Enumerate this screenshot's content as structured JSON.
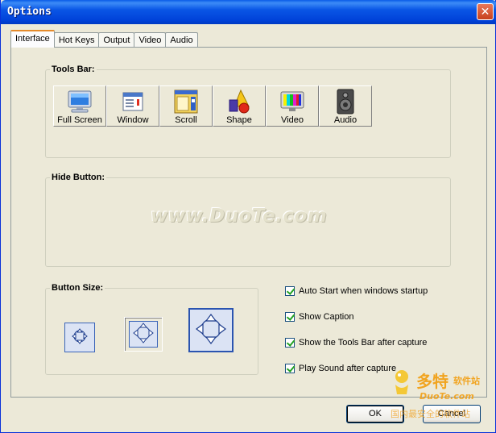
{
  "window": {
    "title": "Options",
    "close_glyph": "✕"
  },
  "tabs": [
    {
      "label": "Interface",
      "active": true
    },
    {
      "label": "Hot Keys",
      "active": false
    },
    {
      "label": "Output",
      "active": false
    },
    {
      "label": "Video",
      "active": false
    },
    {
      "label": "Audio",
      "active": false
    }
  ],
  "tools_bar": {
    "legend": "Tools Bar:",
    "items": [
      {
        "label": "Full Screen",
        "icon": "monitor-icon"
      },
      {
        "label": "Window",
        "icon": "window-icon"
      },
      {
        "label": "Scroll",
        "icon": "scroll-icon"
      },
      {
        "label": "Shape",
        "icon": "shapes-icon"
      },
      {
        "label": "Video",
        "icon": "tv-icon"
      },
      {
        "label": "Audio",
        "icon": "speaker-icon"
      }
    ]
  },
  "hide_button": {
    "legend": "Hide Button:"
  },
  "watermark": "www.DuoTe.com",
  "button_size": {
    "legend": "Button Size:",
    "options": [
      "small",
      "medium",
      "large"
    ],
    "selected": "medium"
  },
  "options": [
    {
      "label": "Auto Start when windows startup",
      "checked": true
    },
    {
      "label": "Show Caption",
      "checked": true
    },
    {
      "label": "Show the Tools Bar after capture",
      "checked": true
    },
    {
      "label": "Play Sound after capture",
      "checked": true
    }
  ],
  "buttons": {
    "ok": "OK",
    "cancel": "Cancel"
  },
  "logo": {
    "brand": "多特",
    "sub": "软件站",
    "url": "DuoTe.com",
    "tagline": "国内最安全的软件站"
  },
  "colors": {
    "title_bar": "#0054e3",
    "face": "#ece9d8",
    "active_tab_accent": "#e68b2c",
    "logo_orange": "#f39800"
  }
}
